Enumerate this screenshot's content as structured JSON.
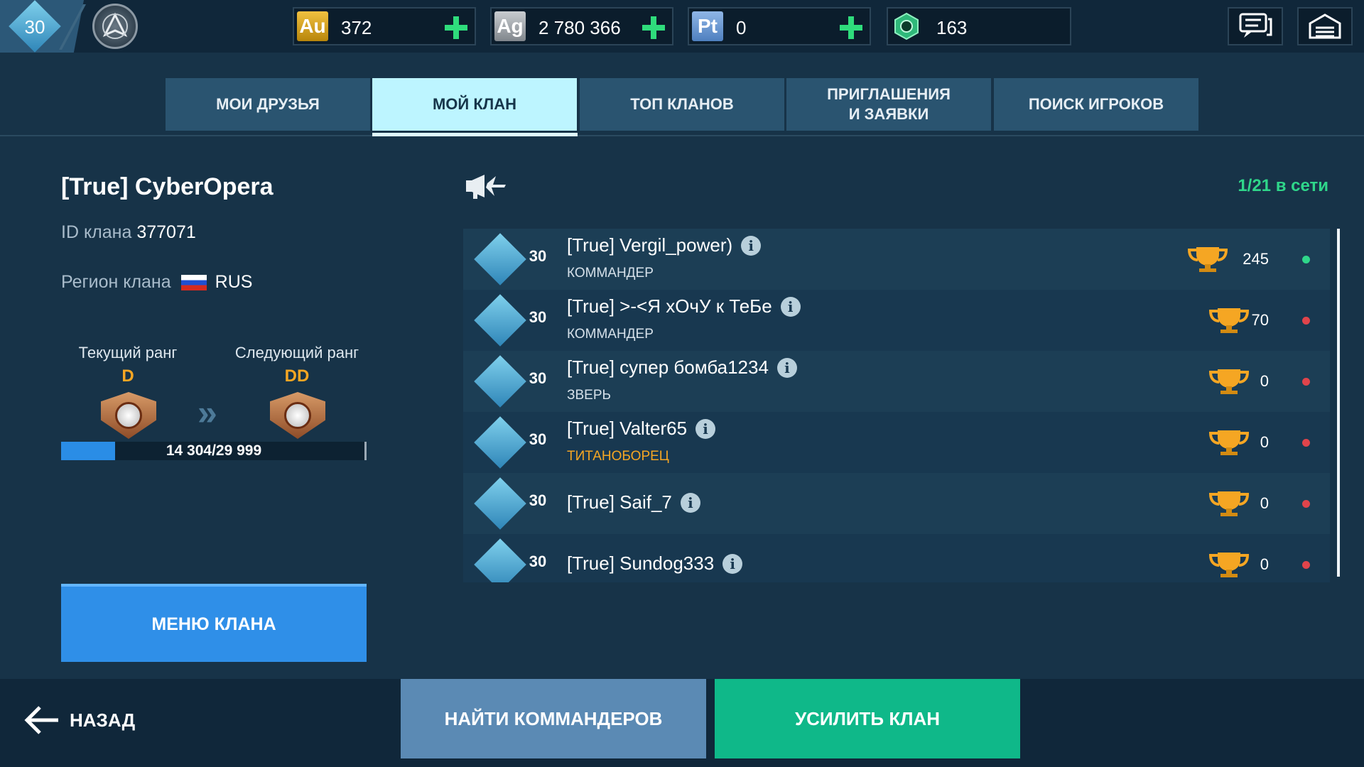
{
  "topbar": {
    "player_level": "30",
    "currencies": [
      {
        "badge": "Au",
        "value": "372",
        "has_plus": true,
        "color": "#f0c040"
      },
      {
        "badge": "Ag",
        "value": "2 780 366",
        "has_plus": true,
        "color": "#c8ccd0"
      },
      {
        "badge": "Pt",
        "value": "0",
        "has_plus": true,
        "color": "#8fb6e6"
      },
      {
        "badge": "hex-gem-icon",
        "value": "163",
        "has_plus": false,
        "color": "#2fd68a"
      }
    ],
    "icons": [
      "chat-icon",
      "hangar-icon"
    ]
  },
  "tabs": [
    {
      "label": "МОИ ДРУЗЬЯ",
      "active": false
    },
    {
      "label": "МОЙ КЛАН",
      "active": true
    },
    {
      "label": "ТОП КЛАНОВ",
      "active": false
    },
    {
      "label": "ПРИГЛАШЕНИЯ\nИ ЗАЯВКИ",
      "active": false
    },
    {
      "label": "ПОИСК ИГРОКОВ",
      "active": false
    }
  ],
  "clan": {
    "name": "[True] CyberOpera",
    "id_label": "ID клана",
    "id_value": "377071",
    "region_label": "Регион клана",
    "region_value": "RUS",
    "current_rank_label": "Текущий ранг",
    "current_rank": "D",
    "next_rank_label": "Следующий ранг",
    "next_rank": "DD",
    "progress_text": "14 304/29 999",
    "progress_fraction": 0.177,
    "menu_button": "МЕНЮ КЛАНА"
  },
  "members_header": {
    "online": "1/21  в сети"
  },
  "members": [
    {
      "name": "[True] Vergil_power)",
      "role": "КОММАНДЕР",
      "role_color": "#d6e1ea",
      "level": "30",
      "score": "245",
      "online": true
    },
    {
      "name": "[True] >-<Я хОчУ к ТеБе",
      "role": "КОММАНДЕР",
      "role_color": "#d6e1ea",
      "level": "30",
      "score": "70",
      "online": false
    },
    {
      "name": "[True] супер бомба1234",
      "role": "ЗВЕРЬ",
      "role_color": "#d6e1ea",
      "level": "30",
      "score": "0",
      "online": false
    },
    {
      "name": "[True] Valter65",
      "role": "ТИТАНОБОРЕЦ",
      "role_color": "#f5a623",
      "level": "30",
      "score": "0",
      "online": false
    },
    {
      "name": "[True] Saif_7",
      "role": "",
      "role_color": "#d6e1ea",
      "level": "30",
      "score": "0",
      "online": false
    },
    {
      "name": "[True] Sundog333",
      "role": "",
      "role_color": "#d6e1ea",
      "level": "30",
      "score": "0",
      "online": false
    }
  ],
  "bottom": {
    "back": "НАЗАД",
    "find_commanders": "НАЙТИ КОММАНДЕРОВ",
    "boost_clan": "УСИЛИТЬ КЛАН"
  },
  "colors": {
    "online": "#2fd68a",
    "offline": "#e0444b",
    "accent_blue": "#2f8fe8",
    "accent_green": "#0fb889"
  }
}
